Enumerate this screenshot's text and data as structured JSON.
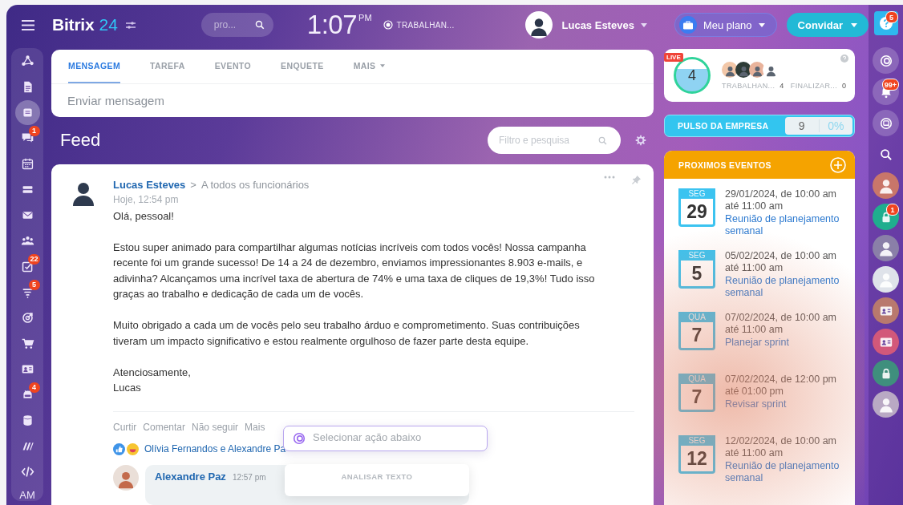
{
  "header": {
    "logo_text": "Bitrix",
    "logo_number": "24",
    "search": {
      "placeholder": "pro..."
    },
    "clock": {
      "time": "1:07",
      "meridiem": "PM"
    },
    "work_status": "TRABALHAN...",
    "user": {
      "name": "Lucas Esteves"
    },
    "plan_button": "Meu plano",
    "invite_button": "Convidar",
    "help_badge": "5"
  },
  "sidebar": {
    "items": [
      {
        "kind": "network",
        "selected": false
      },
      {
        "kind": "document",
        "selected": false
      },
      {
        "kind": "feed",
        "selected": true
      },
      {
        "kind": "chat",
        "selected": false,
        "badge": "1"
      },
      {
        "kind": "calendar",
        "selected": false
      },
      {
        "kind": "drive",
        "selected": false
      },
      {
        "kind": "mail",
        "selected": false
      },
      {
        "kind": "groups",
        "selected": false
      },
      {
        "kind": "tasks",
        "selected": false,
        "badge": "22"
      },
      {
        "kind": "funnel",
        "selected": false,
        "badge": "5"
      },
      {
        "kind": "target",
        "selected": false
      },
      {
        "kind": "cart",
        "selected": false
      },
      {
        "kind": "contact-card",
        "selected": false
      },
      {
        "kind": "robot",
        "selected": false,
        "badge": "4"
      },
      {
        "kind": "database",
        "selected": false
      },
      {
        "kind": "stripes",
        "selected": false
      },
      {
        "kind": "code",
        "selected": false
      }
    ],
    "user_initials": "AM"
  },
  "composer": {
    "tabs": [
      {
        "label": "MENSAGEM",
        "selected": true
      },
      {
        "label": "TAREFA",
        "selected": false
      },
      {
        "label": "EVENTO",
        "selected": false
      },
      {
        "label": "ENQUETE",
        "selected": false
      },
      {
        "label": "MAIS",
        "selected": false
      }
    ],
    "placeholder": "Enviar mensagem"
  },
  "feed": {
    "title": "Feed",
    "filter": {
      "placeholder": "Filtro e pesquisa"
    },
    "post": {
      "author": "Lucas Esteves",
      "separator": ">",
      "audience": "A todos os funcionários",
      "time": "Hoje, 12:54 pm",
      "paragraphs": [
        [
          "Olá, pessoal!"
        ],
        [
          "Estou super animado para compartilhar algumas notícias incríveis com todos vocês! Nossa campanha recente foi um grande sucesso! De 14 a 24 de dezembro, enviamos impressionantes 8.903 e-mails, e adivinha? Alcançamos uma incrível taxa de abertura de 74% e uma taxa de cliques de 19,3%! Tudo isso graças ao trabalho e dedicação de cada um de vocês."
        ],
        [
          "Muito obrigado a cada um de vocês pelo seu trabalho árduo e comprometimento. Suas contribuições tiveram um impacto significativo e estou realmente orgulhoso de fazer parte desta equipe."
        ],
        [
          "Atenciosamente,",
          "Lucas"
        ]
      ],
      "actions": [
        "Curtir",
        "Comentar",
        "Não seguir",
        "Mais"
      ],
      "reactions": "Olívia Fernandos e Alexandre Pa",
      "comment": {
        "author": "Alexandre Paz",
        "time": "12:57 pm"
      },
      "ai_popup": {
        "placeholder": "Selecionar ação abaixo",
        "menu_heading": "ANALISAR TEXTO"
      }
    }
  },
  "right_panel": {
    "live": {
      "label": "LIVE",
      "count": "4",
      "stats": [
        {
          "label": "TRABALHAN...",
          "value": "4"
        },
        {
          "label": "FINALIZAR...",
          "value": "0"
        }
      ]
    },
    "pulse": {
      "label": "PULSO DA EMPRESA",
      "value": "9",
      "percent": "0%"
    },
    "events": {
      "title": "PROXIMOS EVENTOS",
      "items": [
        {
          "weekday": "SEG",
          "day": "29",
          "start": "29/01/2024, de 10:00 am",
          "end": "até 11:00 am",
          "title": "Reunião de planejamento semanal"
        },
        {
          "weekday": "SEG",
          "day": "5",
          "start": "05/02/2024, de 10:00 am",
          "end": "até 11:00 am",
          "title": "Reunião de planejamento semanal"
        },
        {
          "weekday": "QUA",
          "day": "7",
          "start": "07/02/2024, de 10:00 am",
          "end": "até 11:00 am",
          "title": "Planejar sprint"
        },
        {
          "weekday": "QUA",
          "day": "7",
          "start": "07/02/2024, de 12:00 pm",
          "end": "até 01:00 pm",
          "title": "Revisar sprint"
        },
        {
          "weekday": "SEG",
          "day": "12",
          "start": "12/02/2024, de 10:00 am",
          "end": "até 11:00 am",
          "title": "Reunião de planejamento semanal"
        }
      ]
    }
  },
  "rightbar": {
    "items": [
      {
        "kind": "copilot"
      },
      {
        "kind": "bell",
        "badge": "99+"
      },
      {
        "kind": "chat-search"
      },
      {
        "kind": "search"
      },
      {
        "kind": "avatar",
        "color": "#c9766a"
      },
      {
        "kind": "lock",
        "color": "#1fae8e",
        "badge": "1"
      },
      {
        "kind": "avatar",
        "color": "#8a7fa8"
      },
      {
        "kind": "avatar",
        "color": "#dfe3ea"
      },
      {
        "kind": "contact-card",
        "color": "#b9796e"
      },
      {
        "kind": "contact-card",
        "color": "#d2587a"
      },
      {
        "kind": "lock",
        "color": "#3f8f7d"
      },
      {
        "kind": "avatar",
        "color": "#b9a9c4"
      }
    ]
  }
}
